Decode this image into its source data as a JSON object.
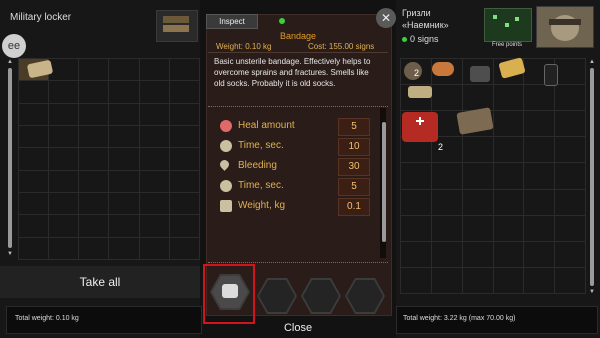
{
  "left": {
    "title": "Military locker",
    "take_all": "Take all",
    "total_weight": "Total weight: 0.10 kg"
  },
  "center": {
    "inspect_tab": "Inspect",
    "item_name": "Bandage",
    "weight_text": "Weight: 0.10 kg",
    "cost_text": "Cost: 155.00 signs",
    "description": "Basic unsterile bandage. Effectively helps to overcome sprains and fractures. Smells like old socks. Probably it is old socks.",
    "stats": [
      {
        "icon": "heal-icon",
        "label": "Heal amount",
        "value": "5"
      },
      {
        "icon": "clock-icon",
        "label": "Time, sec.",
        "value": "10"
      },
      {
        "icon": "blood-drop-icon",
        "label": "Bleeding",
        "value": "30"
      },
      {
        "icon": "clock-icon",
        "label": "Time, sec.",
        "value": "5"
      },
      {
        "icon": "weight-icon",
        "label": "Weight, kg",
        "value": "0.1"
      }
    ],
    "close_label": "Close"
  },
  "right": {
    "name_line1": "Гризли",
    "name_line2": "«Наемник»",
    "signs": "0 signs",
    "free_points": "Free points",
    "total_weight": "Total weight: 3.22 kg (max 70.00 kg)",
    "item_counts": {
      "first": "2",
      "medkit": "2"
    }
  },
  "colors": {
    "accent_orange": "#e09a2c",
    "stat_label": "#e0b050",
    "highlight_red": "#d4141c",
    "green_dot": "#3ad13a"
  }
}
